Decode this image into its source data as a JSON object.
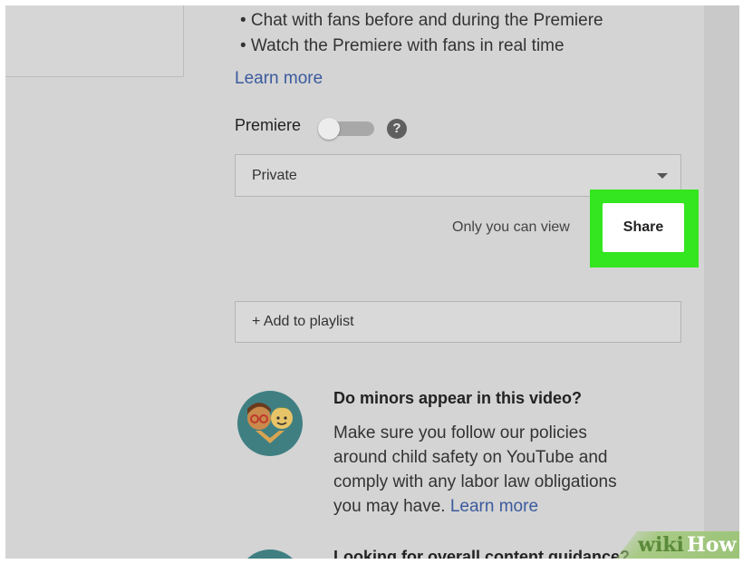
{
  "premiere_features": {
    "bullets": [
      "• Chat with fans before and during the Premiere",
      "• Watch the Premiere with fans in real time"
    ],
    "learn_more": "Learn more"
  },
  "premiere": {
    "label": "Premiere",
    "toggle_on": false,
    "help_icon": "?"
  },
  "visibility": {
    "selected": "Private",
    "note": "Only you can view",
    "share_label": "Share",
    "highlight_color": "#33e61f"
  },
  "playlist": {
    "label": "+ Add to playlist"
  },
  "minors": {
    "title": "Do minors appear in this video?",
    "body_lines": [
      "Make sure you follow our policies",
      "around child safety on YouTube and",
      "comply with any labor law obligations",
      "you may have."
    ],
    "learn_more": "Learn more",
    "icon": "minors-avatar-icon"
  },
  "guidance": {
    "title": "Looking for overall content guidance?"
  },
  "watermark": {
    "wiki": "wiki",
    "how": "How"
  },
  "colors": {
    "link": "#3b5a9e",
    "background": "#d4d4d4"
  }
}
